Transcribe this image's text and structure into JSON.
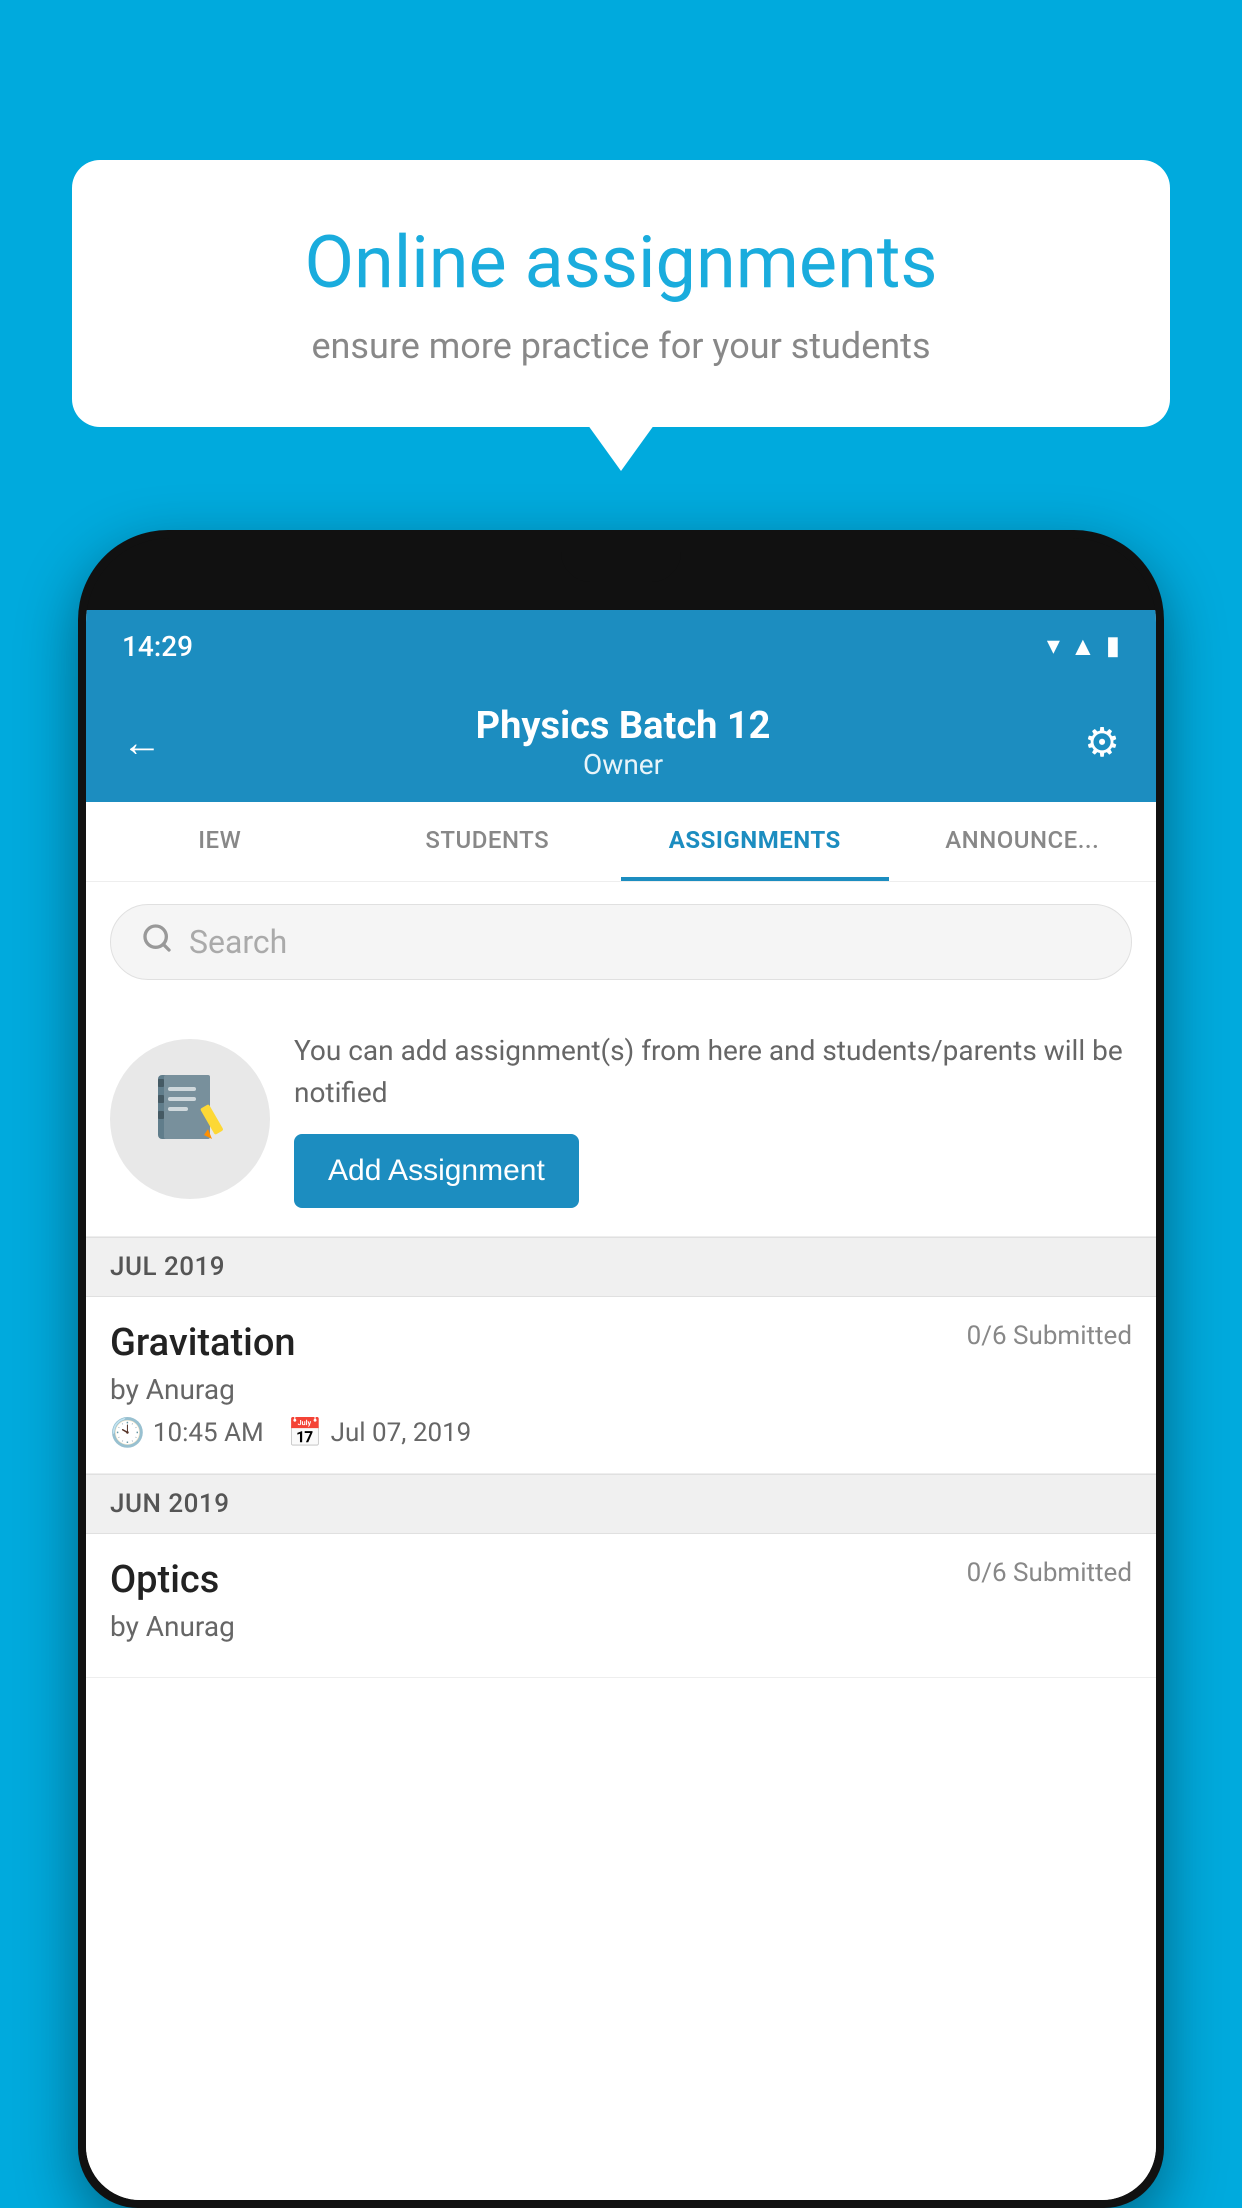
{
  "background_color": "#00AADD",
  "speech_bubble": {
    "title": "Online assignments",
    "subtitle": "ensure more practice for your students"
  },
  "phone": {
    "status_bar": {
      "time": "14:29",
      "wifi_icon": "wifi",
      "signal_icon": "signal",
      "battery_icon": "battery"
    },
    "header": {
      "back_label": "←",
      "title": "Physics Batch 12",
      "subtitle": "Owner",
      "settings_label": "⚙"
    },
    "tabs": [
      {
        "label": "IEW",
        "active": false
      },
      {
        "label": "STUDENTS",
        "active": false
      },
      {
        "label": "ASSIGNMENTS",
        "active": true
      },
      {
        "label": "ANNOUNCEMENTS",
        "active": false
      }
    ],
    "search": {
      "placeholder": "Search"
    },
    "promo": {
      "description": "You can add assignment(s) from here and students/parents will be notified",
      "button_label": "Add Assignment"
    },
    "months": [
      {
        "label": "JUL 2019",
        "assignments": [
          {
            "name": "Gravitation",
            "submitted": "0/6 Submitted",
            "author": "by Anurag",
            "time": "10:45 AM",
            "date": "Jul 07, 2019"
          }
        ]
      },
      {
        "label": "JUN 2019",
        "assignments": [
          {
            "name": "Optics",
            "submitted": "0/6 Submitted",
            "author": "by Anurag",
            "time": "",
            "date": ""
          }
        ]
      }
    ]
  }
}
